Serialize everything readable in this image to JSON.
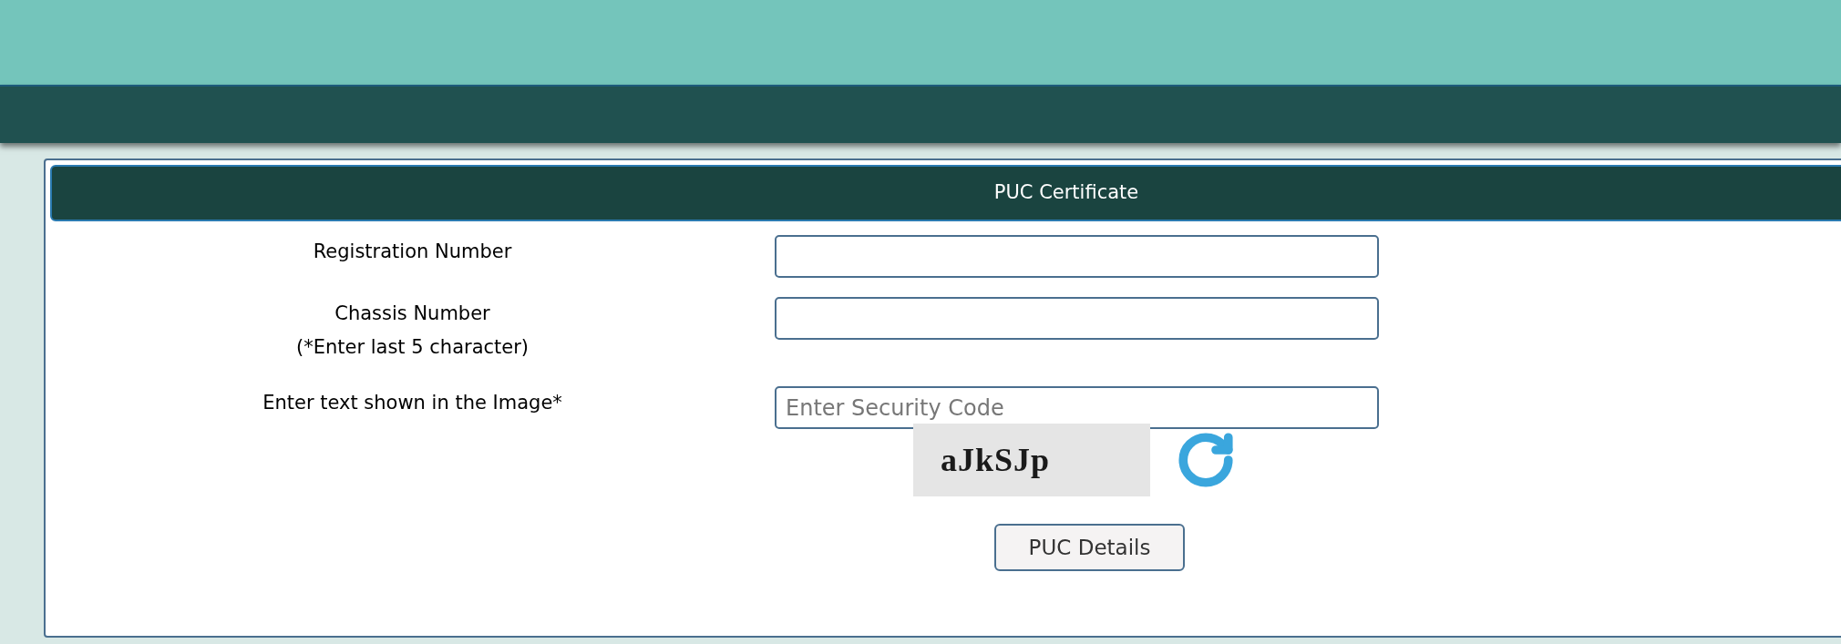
{
  "panel": {
    "title": "PUC Certificate"
  },
  "fields": [
    {
      "label": "Registration Number"
    },
    {
      "label": "Chassis Number",
      "note": "(*Enter last 5 character)"
    },
    {
      "label": "Enter text shown in the Image*",
      "placeholder": "Enter Security Code"
    }
  ],
  "captcha": {
    "text": "aJkSJp"
  },
  "submit": {
    "label": "PUC Details"
  }
}
